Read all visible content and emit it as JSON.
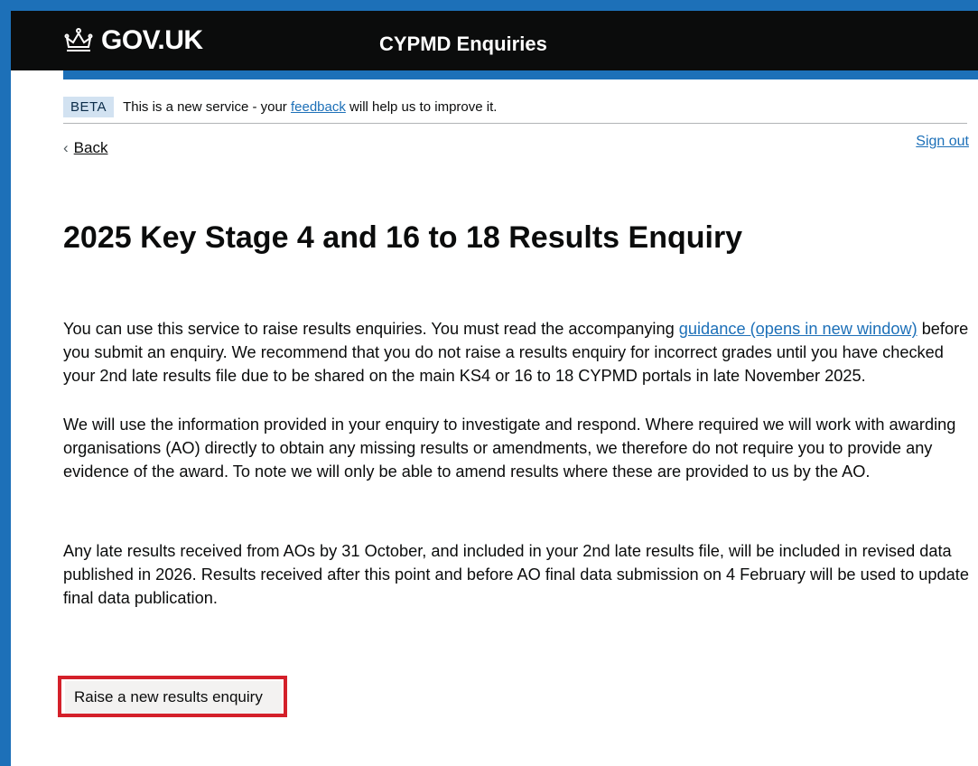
{
  "header": {
    "logo_text": "GOV.UK",
    "service_name": "CYPMD Enquiries"
  },
  "phase_banner": {
    "tag": "BETA",
    "text_before": "This is a new service - your ",
    "link": "feedback",
    "text_after": " will help us to improve it."
  },
  "nav": {
    "back": "Back",
    "sign_out": "Sign out"
  },
  "main": {
    "title": "2025 Key Stage 4 and 16 to 18 Results Enquiry",
    "p1_before": "You can use this service to raise results enquiries. You must read the accompanying ",
    "p1_link": "guidance (opens in new window)",
    "p1_after": " before you submit an enquiry. We recommend that you do not raise a results enquiry for incorrect grades until you have checked your 2nd late results file due to be shared on the main KS4 or 16 to 18 CYPMD portals in late November 2025.",
    "p2": "We will use the information provided in your enquiry to investigate and respond. Where required we will work with awarding organisations (AO) directly to obtain any missing results or amendments, we therefore do not require you to provide any evidence of the award. To note we will only be able to amend results where these are provided to us by the AO.",
    "p3": "Any late results received from AOs by 31 October, and included in your 2nd late results file, will be included in revised data published in 2026. Results received after this point and before AO final data submission on 4 February will be used to update final data publication.",
    "button": "Raise a new results enquiry"
  },
  "colors": {
    "header_bg": "#0b0c0c",
    "brand_blue": "#1d70b8",
    "link": "#1d70b8",
    "highlight": "#d4202a"
  }
}
